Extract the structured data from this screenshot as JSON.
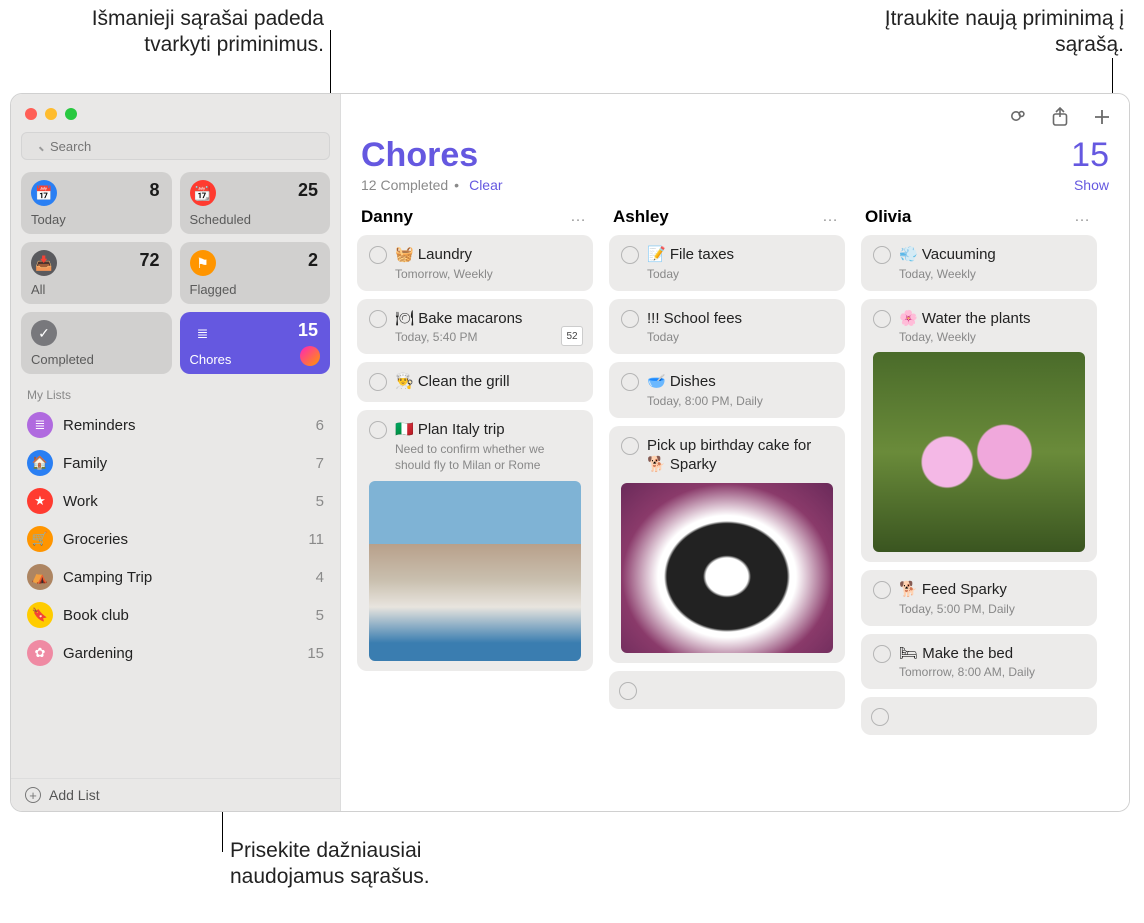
{
  "callouts": {
    "top_left": "Išmanieji sąrašai padeda tvarkyti priminimus.",
    "top_right": "Įtraukite naują priminimą į sąrašą.",
    "bottom": "Prisekite dažniausiai naudojamus sąrašus."
  },
  "search": {
    "placeholder": "Search"
  },
  "smart": [
    {
      "label": "Today",
      "count": "8",
      "color": "#2a7ff3"
    },
    {
      "label": "Scheduled",
      "count": "25",
      "color": "#ff3b30"
    },
    {
      "label": "All",
      "count": "72",
      "color": "#5a5a5e"
    },
    {
      "label": "Flagged",
      "count": "2",
      "color": "#ff9500"
    },
    {
      "label": "Completed",
      "count": "",
      "color": "#78787c"
    },
    {
      "label": "Chores",
      "count": "15",
      "color": "#6558e0",
      "active": true,
      "avatar": true
    }
  ],
  "my_lists_header": "My Lists",
  "lists": [
    {
      "name": "Reminders",
      "count": "6",
      "color": "#b06adf"
    },
    {
      "name": "Family",
      "count": "7",
      "color": "#2a7ff3"
    },
    {
      "name": "Work",
      "count": "5",
      "color": "#ff3b30"
    },
    {
      "name": "Groceries",
      "count": "11",
      "color": "#ff9500"
    },
    {
      "name": "Camping Trip",
      "count": "4",
      "color": "#ad8562"
    },
    {
      "name": "Book club",
      "count": "5",
      "color": "#ffcc00"
    },
    {
      "name": "Gardening",
      "count": "15",
      "color": "#ef8aa3"
    }
  ],
  "add_list": "Add List",
  "main": {
    "title": "Chores",
    "count": "15",
    "completed": "12 Completed",
    "clear": "Clear",
    "show": "Show"
  },
  "columns": [
    {
      "name": "Danny",
      "items": [
        {
          "title": "🧺 Laundry",
          "sub": "Tomorrow, Weekly"
        },
        {
          "title": "🍽 Bake macarons",
          "sub": "Today, 5:40 PM",
          "badge": "52"
        },
        {
          "title": "👨‍🍳 Clean the grill"
        },
        {
          "title": "🇮🇹 Plan Italy trip",
          "note": "Need to confirm whether we should fly to Milan or Rome",
          "img": "italy"
        }
      ]
    },
    {
      "name": "Ashley",
      "items": [
        {
          "title": "📝 File taxes",
          "sub": "Today"
        },
        {
          "title": "!!! School fees",
          "sub": "Today"
        },
        {
          "title": "🥣 Dishes",
          "sub": "Today, 8:00 PM, Daily"
        },
        {
          "title": "Pick up birthday cake for 🐕 Sparky",
          "img": "dog"
        }
      ],
      "empty": true
    },
    {
      "name": "Olivia",
      "items": [
        {
          "title": "💨 Vacuuming",
          "sub": "Today, Weekly"
        },
        {
          "title": "🌸 Water the plants",
          "sub": "Today, Weekly",
          "img": "flower"
        },
        {
          "title": "🐕 Feed Sparky",
          "sub": "Today, 5:00 PM, Daily"
        },
        {
          "title": "🛏 Make the bed",
          "sub": "Tomorrow, 8:00 AM, Daily"
        }
      ],
      "empty": true
    }
  ]
}
